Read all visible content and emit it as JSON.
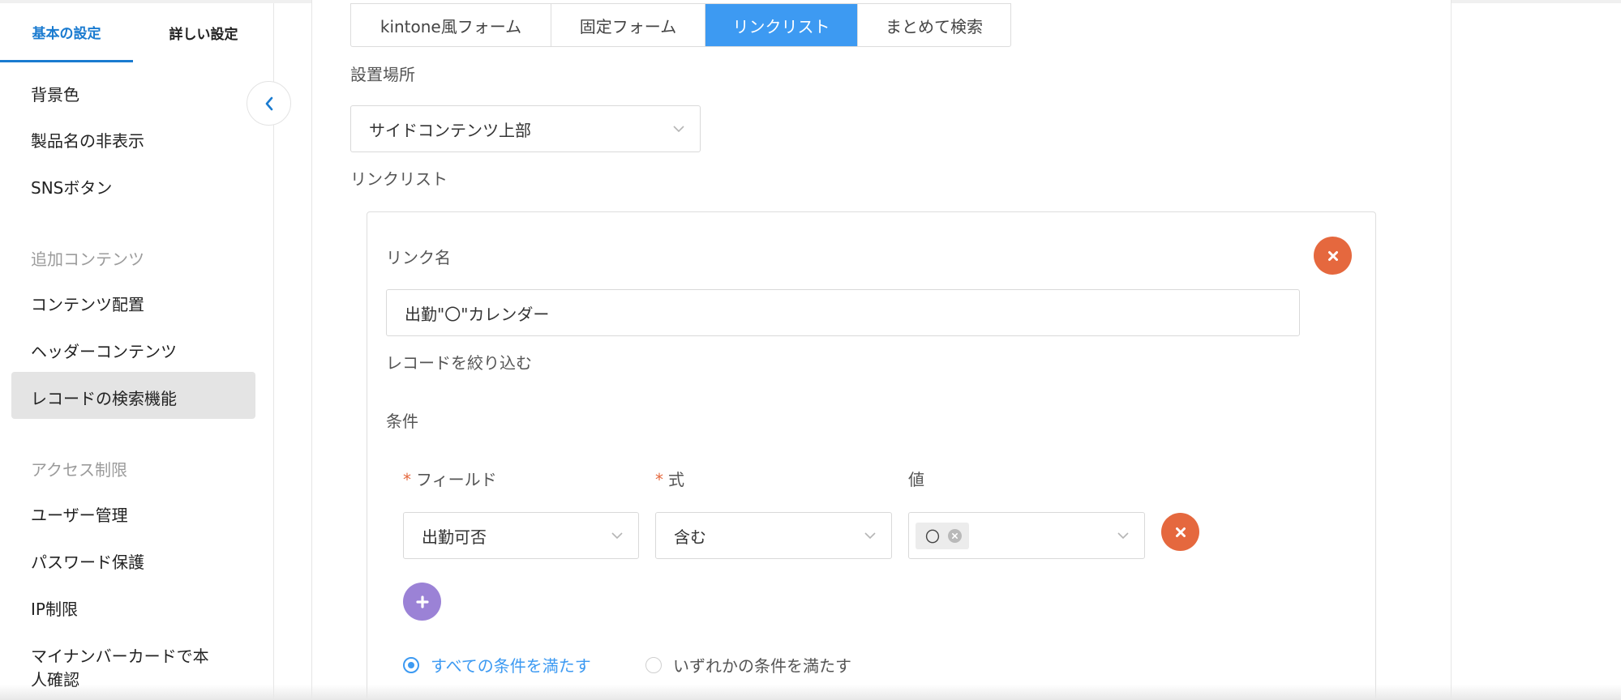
{
  "sidebar": {
    "tabs": [
      {
        "label": "基本の設定"
      },
      {
        "label": "詳しい設定"
      }
    ],
    "items": [
      {
        "label": "背景色"
      },
      {
        "label": "製品名の非表示"
      },
      {
        "label": "SNSボタン"
      },
      {
        "label": "追加コンテンツ"
      },
      {
        "label": "コンテンツ配置"
      },
      {
        "label": "ヘッダーコンテンツ"
      },
      {
        "label": "レコードの検索機能"
      },
      {
        "label": "アクセス制限"
      },
      {
        "label": "ユーザー管理"
      },
      {
        "label": "パスワード保護"
      },
      {
        "label": "IP制限"
      },
      {
        "label": "マイナンバーカードで本"
      },
      {
        "label": "人確認"
      }
    ]
  },
  "main": {
    "tabs": [
      {
        "label": "kintone風フォーム"
      },
      {
        "label": "固定フォーム"
      },
      {
        "label": "リンクリスト"
      },
      {
        "label": "まとめて検索"
      }
    ],
    "placement_label": "設置場所",
    "placement_value": "サイドコンテンツ上部",
    "linklist_label": "リンクリスト",
    "card": {
      "link_name_label": "リンク名",
      "link_name_value": "出勤\"〇\"カレンダー",
      "filter_label": "レコードを絞り込む",
      "condition_label": "条件",
      "required_mark": "*",
      "field_header": "フィールド",
      "expr_header": "式",
      "value_header": "値",
      "field_value": "出勤可否",
      "expr_value": "含む",
      "value_tag": "〇",
      "radio_all": "すべての条件を満たす",
      "radio_any": "いずれかの条件を満たす"
    }
  },
  "colors": {
    "accent": "#3d9af2",
    "sidebar_accent": "#1a7bd0",
    "remove": "#e5683e",
    "add": "#9b82d6"
  },
  "icons": {
    "collapse": "chevron-left-icon",
    "dropdown": "chevron-down-icon",
    "remove": "close-icon",
    "add": "plus-icon"
  }
}
